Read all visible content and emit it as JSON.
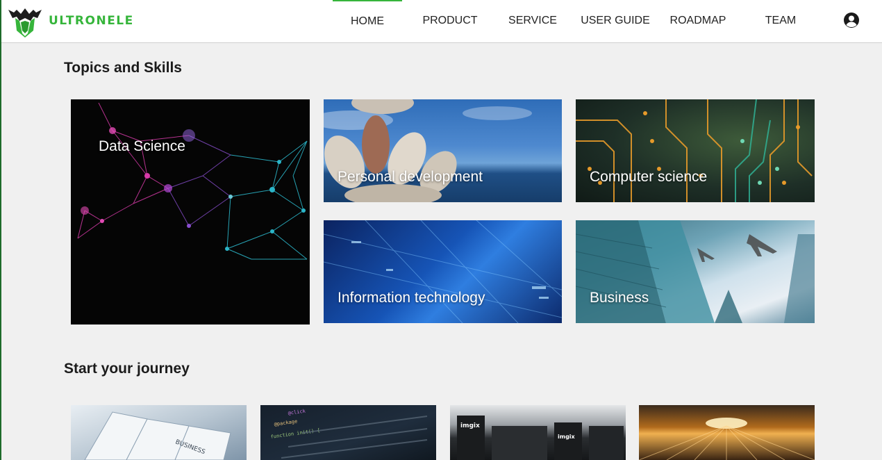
{
  "header": {
    "brand": "ULTRONELE",
    "nav": [
      {
        "label": "HOME",
        "active": true
      },
      {
        "label": "PRODUCT",
        "active": false
      },
      {
        "label": "SERVICE",
        "active": false
      },
      {
        "label": "USER GUIDE",
        "active": false
      },
      {
        "label": "ROADMAP",
        "active": false
      },
      {
        "label": "TEAM",
        "active": false
      }
    ],
    "account_icon": "account-circle-icon",
    "accent_color": "#36b53b"
  },
  "topics": {
    "title": "Topics and Skills",
    "tiles": [
      {
        "label": "Data Science"
      },
      {
        "label": "Personal development"
      },
      {
        "label": "Computer science"
      },
      {
        "label": "Information technology"
      },
      {
        "label": "Business"
      }
    ]
  },
  "journey": {
    "title": "Start your journey",
    "cards": [
      {
        "image": "newspapers-image",
        "text": "BUSINESS"
      },
      {
        "image": "code-screen-image",
        "text": "function init() {"
      },
      {
        "image": "server-rack-image",
        "text": "imgix"
      },
      {
        "image": "data-light-tunnel-image",
        "text": ""
      }
    ]
  }
}
